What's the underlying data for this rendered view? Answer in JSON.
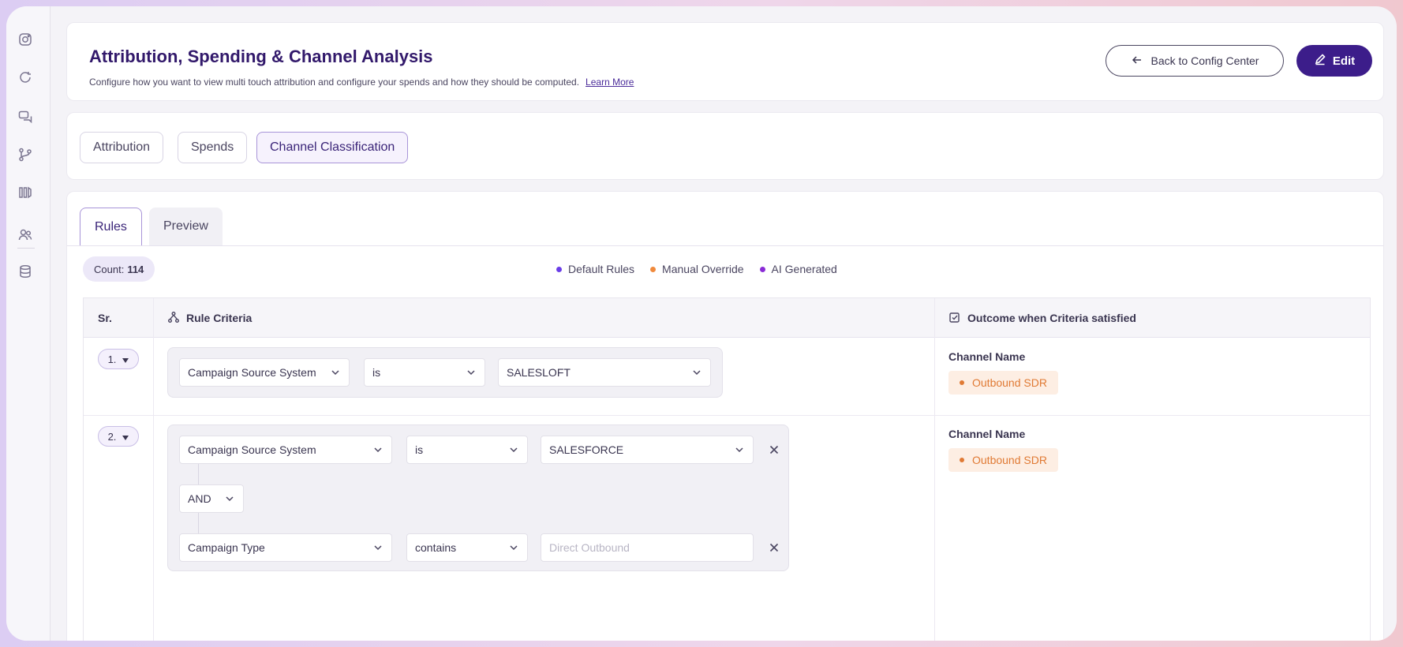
{
  "colors": {
    "brand": "#3c1d8a",
    "default_rules": "#6a3de8",
    "manual_override": "#f08a3c",
    "ai_generated": "#8a2bd6",
    "outcome_text": "#e07a34",
    "outcome_bg": "#fdeee3"
  },
  "sidebar": {
    "icons": [
      "instagram-icon",
      "refresh-icon",
      "chat-bubbles-icon",
      "branch-icon",
      "columns-icon",
      "users-icon",
      "database-icon"
    ]
  },
  "header": {
    "title": "Attribution, Spending & Channel Analysis",
    "subtitle": "Configure how you want to view multi touch attribution and configure your spends and how they should be computed.",
    "learn_more": "Learn More",
    "back_label": "Back to Config Center",
    "edit_label": "Edit"
  },
  "top_tabs": [
    {
      "label": "Attribution"
    },
    {
      "label": "Spends"
    },
    {
      "label": "Channel Classification",
      "active": true
    }
  ],
  "sub_tabs": [
    {
      "label": "Rules",
      "active": true
    },
    {
      "label": "Preview"
    }
  ],
  "count": {
    "label": "Count:",
    "value": "114"
  },
  "legend": [
    {
      "label": "Default Rules"
    },
    {
      "label": "Manual Override"
    },
    {
      "label": "AI Generated"
    }
  ],
  "table": {
    "col_sn": "Sr.",
    "col_criteria": "Rule Criteria",
    "col_outcome": "Outcome when Criteria satisfied"
  },
  "rules": [
    {
      "sn": "1.",
      "c1": {
        "field": "Campaign Source System",
        "op": "is",
        "value": "SALESLOFT"
      },
      "outcome_label": "Channel Name",
      "outcome_value": "Outbound SDR"
    },
    {
      "sn": "2.",
      "c1": {
        "field": "Campaign Source System",
        "op": "is",
        "value": "SALESFORCE"
      },
      "joiner": "AND",
      "c2": {
        "field": "Campaign Type",
        "op": "contains",
        "placeholder": "Direct Outbound"
      },
      "outcome_label": "Channel Name",
      "outcome_value": "Outbound SDR"
    }
  ]
}
